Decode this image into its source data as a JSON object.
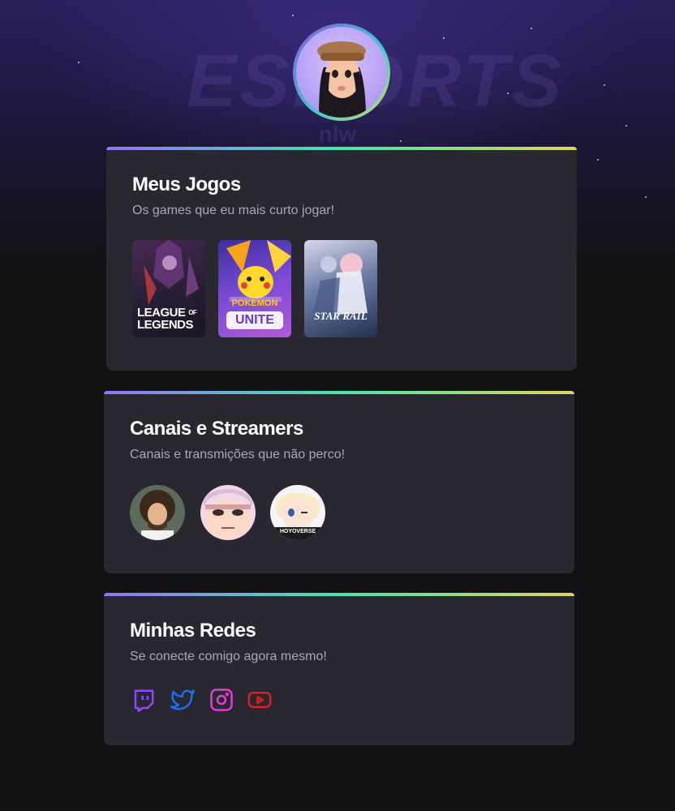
{
  "games_section": {
    "title": "Meus Jogos",
    "subtitle": "Os games que eu mais curto jogar!",
    "games": [
      {
        "name": "League of Legends",
        "label_line1": "LEAGUE",
        "label_of": "OF",
        "label_line2": "LEGENDS"
      },
      {
        "name": "Pokémon Unite",
        "label_line1": "POKÉMON",
        "label_line2": "UNITE"
      },
      {
        "name": "Honkai: Star Rail",
        "label_line1": "STAR RAIL"
      }
    ]
  },
  "streamers_section": {
    "title": "Canais e Streamers",
    "subtitle": "Canais e transmições que não perco!",
    "streamers": [
      {
        "name": "Bob Ross"
      },
      {
        "name": "anime-face"
      },
      {
        "name": "HoYoverse",
        "caption": "HOYOVERSE"
      }
    ]
  },
  "socials_section": {
    "title": "Minhas Redes",
    "subtitle": "Se conecte comigo agora mesmo!",
    "networks": [
      {
        "name": "Twitch",
        "icon": "twitch-icon",
        "color": "#9146ff"
      },
      {
        "name": "Twitter",
        "icon": "twitter-icon",
        "color": "#1d6ff2"
      },
      {
        "name": "Instagram",
        "icon": "instagram-icon",
        "color": "#e23bd7"
      },
      {
        "name": "YouTube",
        "icon": "youtube-icon",
        "color": "#e01e28"
      }
    ]
  },
  "background": {
    "logo_text": "ESPORTS",
    "sub_text": "nlw"
  },
  "colors": {
    "page_bg": "#121214",
    "card_bg": "#29272f",
    "gradient": [
      "#9572fc",
      "#43e7ad",
      "#e2d45c"
    ]
  }
}
